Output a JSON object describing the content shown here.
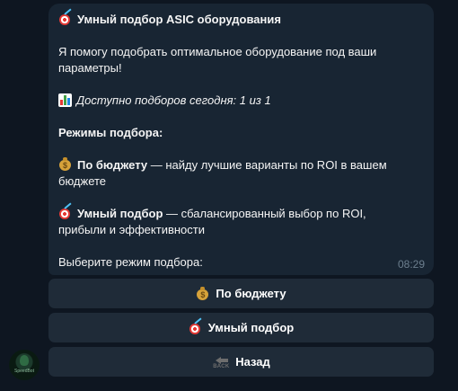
{
  "message": {
    "title": "Умный подбор ASIC оборудования",
    "intro": "Я помогу подобрать оптимальное оборудование под ваши",
    "intro2": "параметры!",
    "available": "Доступно подборов сегодня: 1 из 1",
    "modes_header": "Режимы подбора:",
    "mode1_name": "По бюджету",
    "mode1_desc": " — найду лучшие варианты по ROI в вашем",
    "mode1_desc2": "бюджете",
    "mode2_name": "Умный подбор",
    "mode2_desc": " — сбалансированный выбор по ROI,",
    "mode2_desc2": "прибыли и эффективности",
    "prompt": "Выберите режим подбора:",
    "time": "08:29"
  },
  "keyboard": {
    "budget_label": "По бюджету",
    "smart_label": "Умный подбор",
    "back_label": "Назад"
  },
  "icons": {
    "title": "dart-icon",
    "available": "bar-chart-icon",
    "budget": "money-bag-icon",
    "smart": "dart-icon",
    "back": "back-arrow-icon"
  },
  "colors": {
    "background": "#0e1621",
    "bubble": "#182533",
    "button": "#1f2b38",
    "time": "#6d7f8f"
  },
  "avatar": {
    "label": "SpeedBot"
  },
  "back_icon_label": "BACK"
}
